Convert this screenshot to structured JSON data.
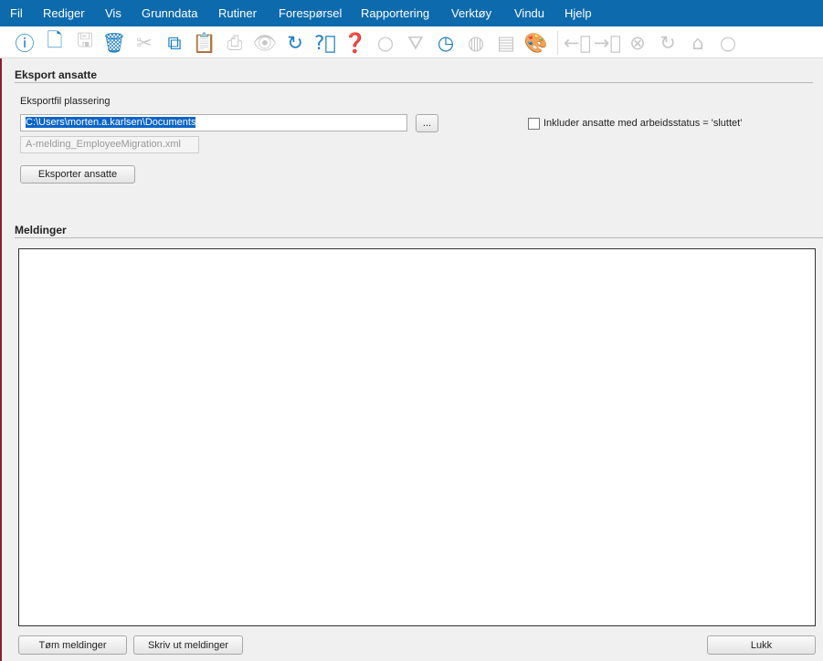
{
  "menu": [
    "Fil",
    "Rediger",
    "Vis",
    "Grunndata",
    "Rutiner",
    "Forespørsel",
    "Rapportering",
    "Verktøy",
    "Vindu",
    "Hjelp"
  ],
  "toolbar": [
    {
      "icon": "info-icon",
      "glyph": "ⓘ",
      "enabled": true
    },
    {
      "icon": "new-document-icon",
      "glyph": "🗋",
      "enabled": true
    },
    {
      "icon": "save-icon",
      "glyph": "🖫",
      "enabled": false
    },
    {
      "icon": "delete-icon",
      "glyph": "🗑",
      "enabled": true
    },
    {
      "icon": "cut-icon",
      "glyph": "✂",
      "enabled": false
    },
    {
      "icon": "copy-icon",
      "glyph": "⧉",
      "enabled": true
    },
    {
      "icon": "paste-icon",
      "glyph": "📋",
      "enabled": true
    },
    {
      "icon": "print-icon",
      "glyph": "⎙",
      "enabled": false
    },
    {
      "icon": "preview-icon",
      "glyph": "👁",
      "enabled": false
    },
    {
      "icon": "refresh-icon",
      "glyph": "↻",
      "enabled": true
    },
    {
      "icon": "help-icon",
      "glyph": "?⃝",
      "enabled": true
    },
    {
      "icon": "document-help-icon",
      "glyph": "❓",
      "enabled": true
    },
    {
      "icon": "search-icon",
      "glyph": "○",
      "enabled": false
    },
    {
      "icon": "filter-icon",
      "glyph": "⛛",
      "enabled": false
    },
    {
      "icon": "history-icon",
      "glyph": "◷",
      "enabled": true
    },
    {
      "icon": "globe-icon",
      "glyph": "◍",
      "enabled": false
    },
    {
      "icon": "note-icon",
      "glyph": "▤",
      "enabled": false
    },
    {
      "icon": "palette-icon",
      "glyph": "🎨",
      "enabled": true
    },
    {
      "icon": "back-icon",
      "glyph": "←⃝",
      "enabled": false
    },
    {
      "icon": "forward-icon",
      "glyph": "→⃝",
      "enabled": false
    },
    {
      "icon": "stop-icon",
      "glyph": "⊗",
      "enabled": false
    },
    {
      "icon": "reload-icon",
      "glyph": "↻",
      "enabled": false
    },
    {
      "icon": "home-icon",
      "glyph": "⌂",
      "enabled": false
    },
    {
      "icon": "find-icon",
      "glyph": "○",
      "enabled": false
    }
  ],
  "export": {
    "title": "Eksport ansatte",
    "location_label": "Eksportfil plassering",
    "path_value": "C:\\Users\\morten.a.karlsen\\Documents",
    "browse_label": "...",
    "filename": "A-melding_EmployeeMigration.xml",
    "export_button": "Eksporter ansatte",
    "include_checkbox_label": "Inkluder ansatte med arbeidsstatus = 'sluttet'",
    "include_checked": false
  },
  "messages": {
    "title": "Meldinger",
    "content": "",
    "clear_button": "Tøm meldinger",
    "print_button": "Skriv ut meldinger",
    "close_button": "Lukk"
  }
}
